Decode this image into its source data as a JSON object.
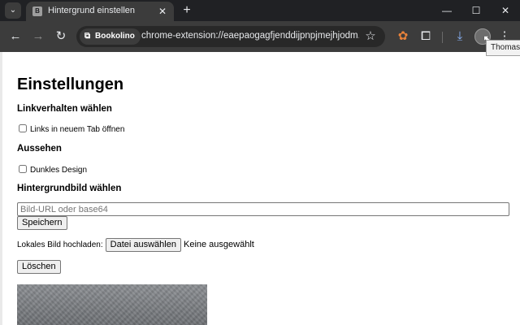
{
  "browser": {
    "tab": {
      "favicon": "B",
      "title": "Hintergrund einstellen",
      "close_icon": "close-icon"
    },
    "new_tab_icon": "plus-icon",
    "window_controls": [
      "minimize-icon",
      "maximize-icon",
      "close-icon"
    ],
    "toolbar": {
      "site_chip": "Bookolino",
      "url": "chrome-extension://eaepaogagfjenddijpnpjmejhjodm...",
      "icons": [
        "back-icon",
        "forward-icon",
        "reload-icon",
        "bookmark-star-icon",
        "extension-icon",
        "puzzle-icon",
        "download-icon",
        "profile-avatar",
        "menu-icon"
      ]
    },
    "tooltip": "Thomas"
  },
  "page": {
    "title": "Einstellungen",
    "link_section": {
      "heading": "Linkverhalten wählen",
      "checkbox_label": "Links in neuem Tab öffnen",
      "checked": false
    },
    "appearance_section": {
      "heading": "Aussehen",
      "checkbox_label": "Dunkles Design",
      "checked": false
    },
    "background_section": {
      "heading": "Hintergrundbild wählen",
      "input_value": "",
      "input_placeholder": "Bild-URL oder base64",
      "save_label": "Speichern",
      "upload_label": "Lokales Bild hochladen:",
      "choose_file_label": "Datei auswählen",
      "no_file_text": "Keine ausgewählt",
      "delete_label": "Löschen"
    }
  },
  "colors": {
    "tab_strip": "#202124",
    "toolbar": "#3c3c3c",
    "omnibox": "#282828",
    "download_accent": "#8ab4f8",
    "extension_accent": "#e8823a"
  }
}
